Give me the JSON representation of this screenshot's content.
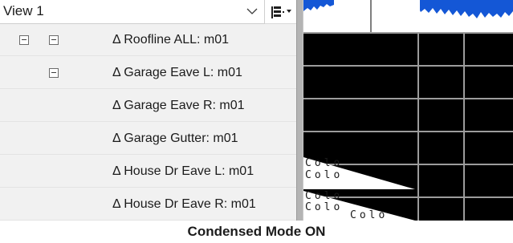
{
  "view": {
    "selected": "View 1",
    "chevron_icon": "chevron-down-icon",
    "layout_icon": "split-layout-icon"
  },
  "tree": {
    "rows": [
      {
        "label": "Δ Roofline ALL: m01",
        "expanders": 2
      },
      {
        "label": "Δ Garage Eave L: m01",
        "expanders": 1
      },
      {
        "label": "Δ Garage Eave R: m01",
        "expanders": 0
      },
      {
        "label": "Δ Garage Gutter: m01",
        "expanders": 0
      },
      {
        "label": "Δ House Dr Eave L: m01",
        "expanders": 0
      },
      {
        "label": "Δ House Dr Eave R: m01",
        "expanders": 0
      }
    ]
  },
  "plot": {
    "background_color": "#000000",
    "waveform_color": "#1457d6",
    "track_label_fragments": [
      "Colo",
      "Colo",
      "Colo",
      "Colo",
      "Colo"
    ]
  },
  "caption": "Condensed Mode ON"
}
